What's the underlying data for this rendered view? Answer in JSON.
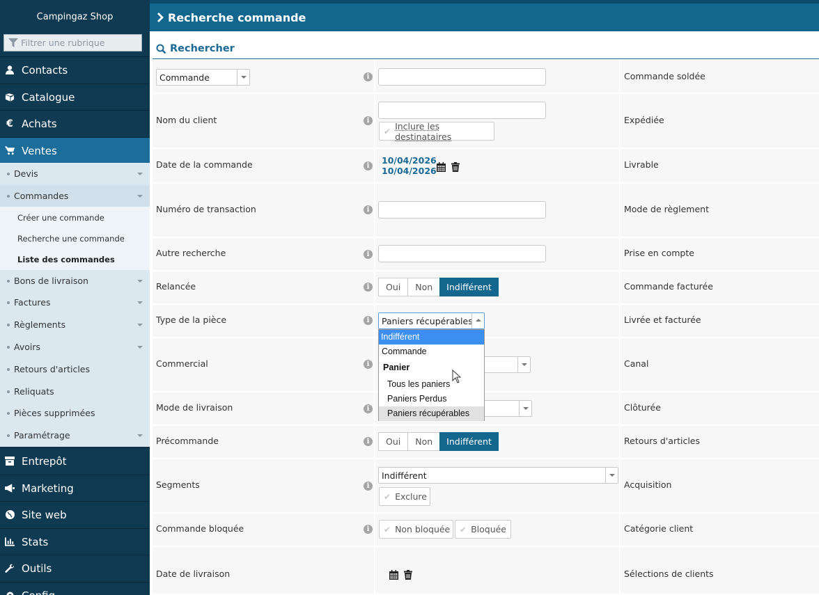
{
  "sidebar": {
    "brand": "Campingaz Shop",
    "filter_placeholder": "Filtrer une rubrique",
    "top_items": [
      {
        "label": "Contacts",
        "icon": "user-icon"
      },
      {
        "label": "Catalogue",
        "icon": "book-icon"
      },
      {
        "label": "Achats",
        "icon": "euro-icon"
      },
      {
        "label": "Ventes",
        "icon": "cart-icon"
      }
    ],
    "ventes_subitems": [
      {
        "label": "Devis"
      },
      {
        "label": "Commandes"
      },
      {
        "label": "Bons de livraison"
      },
      {
        "label": "Factures"
      },
      {
        "label": "Règlements"
      },
      {
        "label": "Avoirs"
      },
      {
        "label": "Retours d'articles"
      },
      {
        "label": "Reliquats"
      },
      {
        "label": "Pièces supprimées"
      },
      {
        "label": "Paramétrage"
      }
    ],
    "commandes_children": [
      {
        "label": "Créer une commande"
      },
      {
        "label": "Recherche une commande"
      },
      {
        "label": "Liste des commandes"
      }
    ],
    "bottom_items": [
      {
        "label": "Entrepôt",
        "icon": "warehouse-icon"
      },
      {
        "label": "Marketing",
        "icon": "megaphone-icon"
      },
      {
        "label": "Site web",
        "icon": "globe-icon"
      },
      {
        "label": "Stats",
        "icon": "bar-chart-icon"
      },
      {
        "label": "Outils",
        "icon": "wrench-icon"
      },
      {
        "label": "Config",
        "icon": "gear-icon"
      }
    ]
  },
  "header": {
    "title": "Recherche commande"
  },
  "section": {
    "title": "Rechercher"
  },
  "form": {
    "rows": [
      {
        "label": "Commande",
        "right": "Commande soldée"
      },
      {
        "label": "Nom du client",
        "right": "Expédiée"
      },
      {
        "label": "Date de la commande",
        "right": "Livrable"
      },
      {
        "label": "Numéro de transaction",
        "right": "Mode de règlement"
      },
      {
        "label": "Autre recherche",
        "right": "Prise en compte"
      },
      {
        "label": "Relancée",
        "right": "Commande facturée"
      },
      {
        "label": "Type de la pièce",
        "right": "Livrée et facturée"
      },
      {
        "label": "Commercial",
        "right": "Canal"
      },
      {
        "label": "Mode de livraison",
        "right": "Clôturée"
      },
      {
        "label": "Précommande",
        "right": "Retours d'articles"
      },
      {
        "label": "Segments",
        "right": "Acquisition"
      },
      {
        "label": "Commande bloquée",
        "right": "Catégorie client"
      },
      {
        "label": "Date de livraison",
        "right": "Sélections de clients"
      }
    ],
    "commande_select": "Commande",
    "include_recipients": "Inclure les destinataires",
    "date_from": "10/04/2026",
    "date_to": "10/04/2026",
    "tri": {
      "yes": "Oui",
      "no": "Non",
      "any": "Indifférent"
    },
    "type_piece_value": "Paniers récupérables",
    "segments_value": "Indifférent",
    "exclude": "Exclure",
    "non_bloquee": "Non bloquée",
    "bloquee": "Bloquée"
  },
  "dropdown": {
    "options": [
      {
        "label": "Indifférent",
        "style": "highlighted"
      },
      {
        "label": "Commande",
        "style": "normal"
      },
      {
        "label": "Panier",
        "style": "group"
      },
      {
        "label": "Tous les paniers",
        "style": "indented"
      },
      {
        "label": "Paniers Perdus",
        "style": "indented"
      },
      {
        "label": "Paniers récupérables",
        "style": "selected"
      }
    ]
  },
  "colors": {
    "sidebar": "#0f3a52",
    "accent": "#13678f",
    "submenu": "#dbe8f0"
  }
}
